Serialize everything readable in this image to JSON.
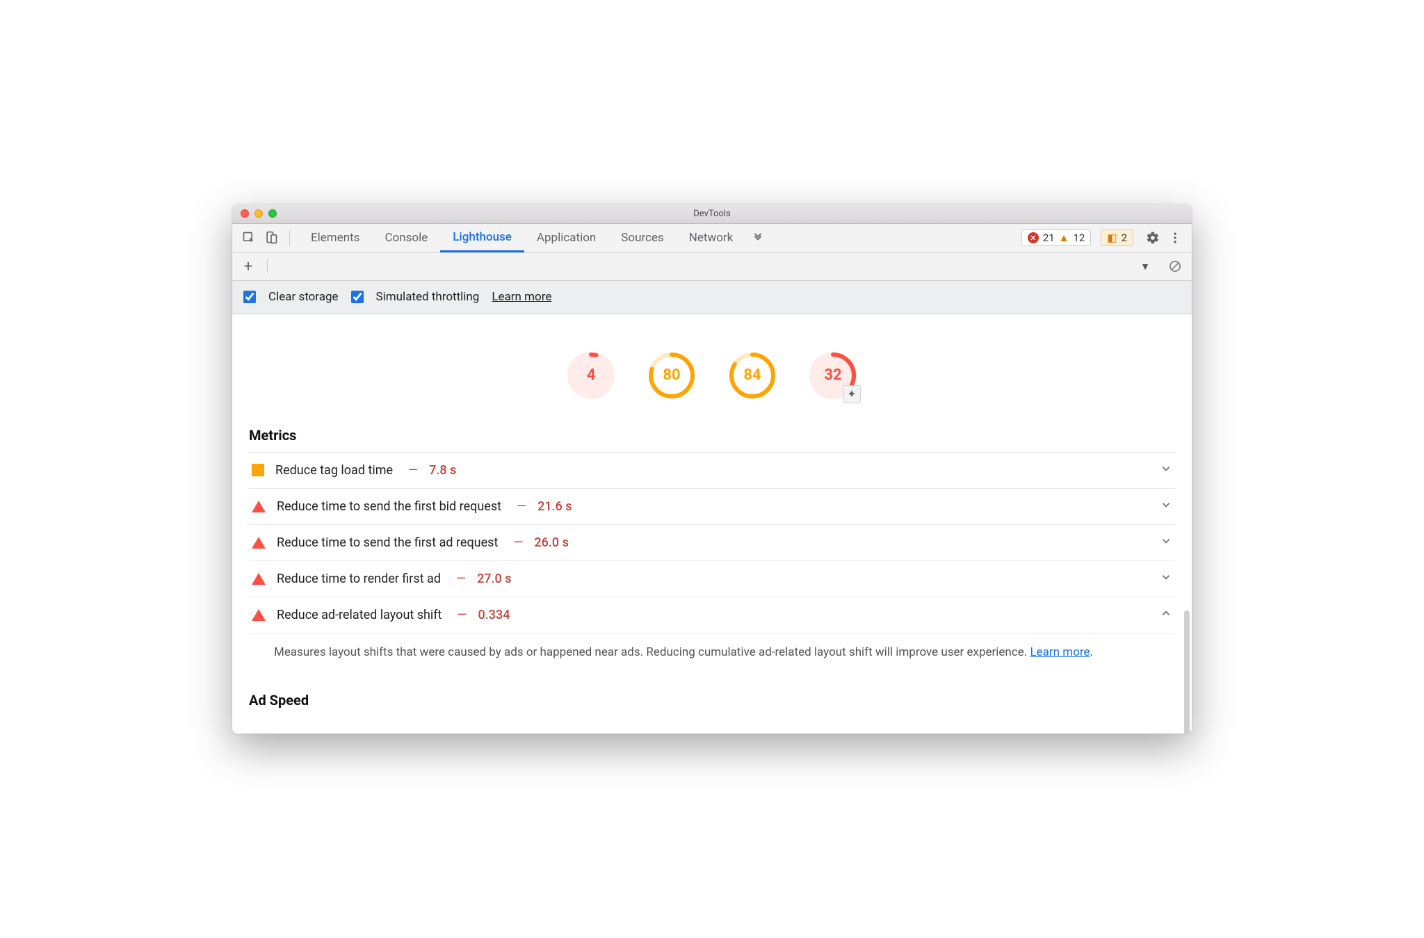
{
  "window": {
    "title": "DevTools"
  },
  "tabs": [
    "Elements",
    "Console",
    "Lighthouse",
    "Application",
    "Sources",
    "Network"
  ],
  "active_tab_index": 2,
  "counts": {
    "errors": 21,
    "warnings": 12
  },
  "notifications": 2,
  "options": {
    "clear_storage": "Clear storage",
    "simulated_throttling": "Simulated throttling",
    "learn_more": "Learn more"
  },
  "gauges": [
    {
      "score": 4,
      "color": "red",
      "pct": 4
    },
    {
      "score": 80,
      "color": "orange",
      "pct": 80
    },
    {
      "score": 84,
      "color": "orange",
      "pct": 84
    },
    {
      "score": 32,
      "color": "red",
      "pct": 32
    }
  ],
  "sections": {
    "metrics_title": "Metrics",
    "ad_speed_title": "Ad Speed"
  },
  "metrics": [
    {
      "shape": "sq",
      "label": "Reduce tag load time",
      "val": "7.8 s",
      "expanded": false
    },
    {
      "shape": "tri",
      "label": "Reduce time to send the first bid request",
      "val": "21.6 s",
      "expanded": false
    },
    {
      "shape": "tri",
      "label": "Reduce time to send the first ad request",
      "val": "26.0 s",
      "expanded": false
    },
    {
      "shape": "tri",
      "label": "Reduce time to render first ad",
      "val": "27.0 s",
      "expanded": false
    },
    {
      "shape": "tri",
      "label": "Reduce ad-related layout shift",
      "val": "0.334",
      "expanded": true,
      "desc": "Measures layout shifts that were caused by ads or happened near ads. Reducing cumulative ad-related layout shift will improve user experience. ",
      "learn_more": "Learn more"
    }
  ]
}
